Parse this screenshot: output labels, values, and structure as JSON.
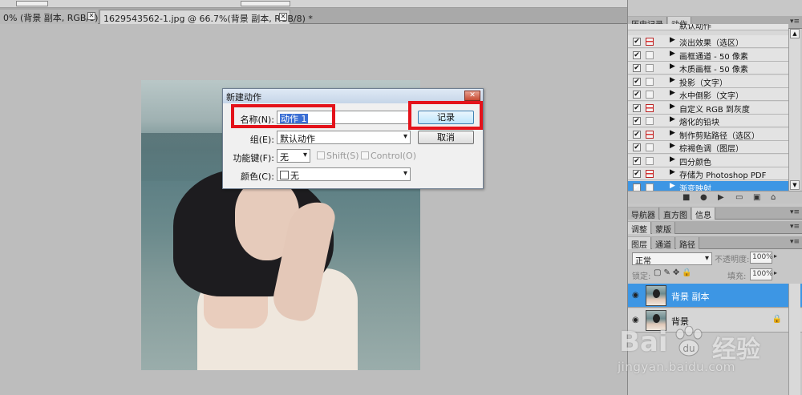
{
  "document_tabs": [
    {
      "label": "0% (背景 副本, RGB/8) *",
      "close": "✕"
    },
    {
      "label": "1629543562-1.jpg @ 66.7%(背景 副本, RGB/8) *",
      "close": "✕"
    }
  ],
  "dialog": {
    "title": "新建动作",
    "close_label": "✕",
    "name_label": "名称(N):",
    "name_value": "动作 1",
    "group_label": "组(E):",
    "group_value": "默认动作",
    "fkey_label": "功能键(F):",
    "fkey_value": "无",
    "shift_label": "Shift(S)",
    "control_label": "Control(O)",
    "color_label": "颜色(C):",
    "color_value": "无",
    "record_button": "记录",
    "cancel_button": "取消",
    "highlight_color": "#e4131b"
  },
  "actions_panel": {
    "tabs": [
      "历史记录",
      "动作"
    ],
    "group_header": "默认动作",
    "items": [
      {
        "name": "淡出效果（选区）",
        "checked": true,
        "dialog": true
      },
      {
        "name": "画框通道 - 50 像素",
        "checked": true,
        "dialog": false
      },
      {
        "name": "木质画框 - 50 像素",
        "checked": true,
        "dialog": false
      },
      {
        "name": "投影（文字）",
        "checked": true,
        "dialog": false
      },
      {
        "name": "水中倒影（文字）",
        "checked": true,
        "dialog": false
      },
      {
        "name": "自定义 RGB 到灰度",
        "checked": true,
        "dialog": true
      },
      {
        "name": "熔化的铅块",
        "checked": true,
        "dialog": false
      },
      {
        "name": "制作剪贴路径（选区）",
        "checked": true,
        "dialog": true
      },
      {
        "name": "棕褐色调（图层）",
        "checked": true,
        "dialog": false
      },
      {
        "name": "四分颜色",
        "checked": true,
        "dialog": false
      },
      {
        "name": "存储为 Photoshop PDF",
        "checked": true,
        "dialog": true
      },
      {
        "name": "渐变映射",
        "checked": true,
        "dialog": false,
        "selected": true
      }
    ],
    "selection_color": "#3d96e4"
  },
  "nav_tabs": [
    "导航器",
    "直方图",
    "信息"
  ],
  "adjust_tabs": [
    "调整",
    "蒙版"
  ],
  "layers_tabs": [
    "图层",
    "通道",
    "路径"
  ],
  "layers": {
    "blend_mode": "正常",
    "opacity_label": "不透明度:",
    "opacity_value": "100%",
    "lock_label": "锁定:",
    "fill_label": "填充:",
    "fill_value": "100%",
    "items": [
      {
        "name": "背景 副本",
        "selected": true
      },
      {
        "name": "背景",
        "selected": false,
        "locked": true
      }
    ]
  },
  "watermark": {
    "brand_left": "Bai",
    "brand_right": "经验",
    "url": "jingyan.baidu.com"
  }
}
